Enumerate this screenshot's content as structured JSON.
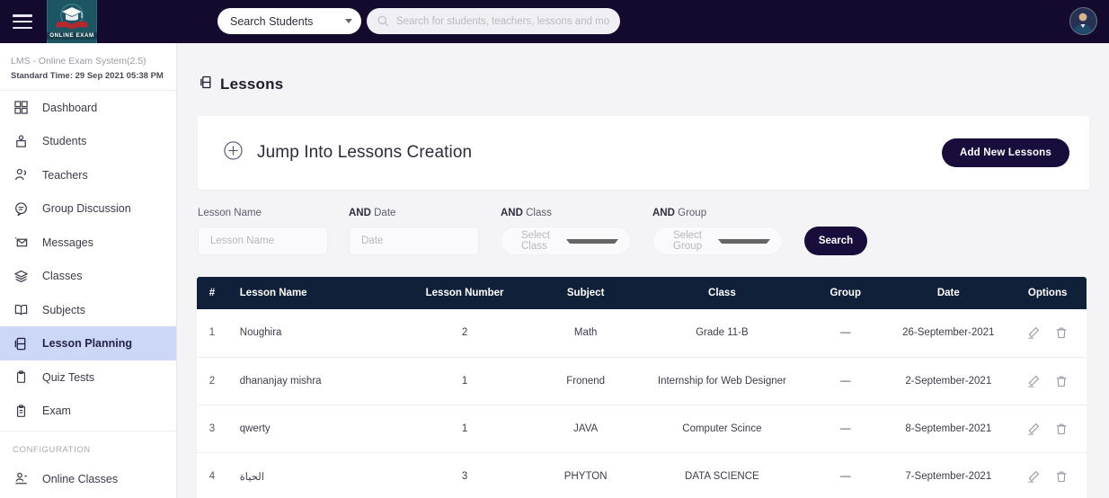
{
  "header": {
    "menu_icon": "hamburger-icon",
    "logo_text": "ONLINE EXAM",
    "search_scope": "Search Students",
    "search_placeholder": "Search for students, teachers, lessons and more..",
    "search_value": "",
    "avatar_icon": "user-avatar"
  },
  "sidebar": {
    "system_title": "LMS - Online Exam System(2.5)",
    "system_time": "Standard Time: 29 Sep 2021 05:38 PM",
    "items": [
      {
        "label": "Dashboard",
        "icon": "grid-icon",
        "active": false
      },
      {
        "label": "Students",
        "icon": "student-icon",
        "active": false
      },
      {
        "label": "Teachers",
        "icon": "teacher-icon",
        "active": false
      },
      {
        "label": "Group Discussion",
        "icon": "chat-icon",
        "active": false
      },
      {
        "label": "Messages",
        "icon": "envelope-icon",
        "active": false
      },
      {
        "label": "Classes",
        "icon": "layers-icon",
        "active": false
      },
      {
        "label": "Subjects",
        "icon": "book-icon",
        "active": false
      },
      {
        "label": "Lesson Planning",
        "icon": "lesson-icon",
        "active": true
      },
      {
        "label": "Quiz Tests",
        "icon": "clipboard-icon",
        "active": false
      },
      {
        "label": "Exam",
        "icon": "exam-clipboard-icon",
        "active": false
      }
    ],
    "section_label": "CONFIGURATION",
    "config_items": [
      {
        "label": "Online Classes",
        "icon": "online-class-icon",
        "active": false
      }
    ]
  },
  "main": {
    "page_title": "Lessons",
    "page_icon": "lesson-icon",
    "jump_card": {
      "plus_icon": "plus-circle-icon",
      "title": "Jump Into Lessons Creation",
      "add_button": "Add New Lessons"
    },
    "filters": {
      "lesson_name_label": "Lesson Name",
      "lesson_name_placeholder": "Lesson Name",
      "lesson_name_value": "",
      "date_label_prefix": "AND",
      "date_label": "Date",
      "date_placeholder": "Date",
      "date_value": "",
      "class_label_prefix": "AND",
      "class_label": "Class",
      "class_value": "Select Class",
      "group_label_prefix": "AND",
      "group_label": "Group",
      "group_value": "Select Group",
      "search_button": "Search"
    },
    "table": {
      "columns": [
        "#",
        "Lesson Name",
        "Lesson Number",
        "Subject",
        "Class",
        "Group",
        "Date",
        "Options"
      ],
      "rows": [
        {
          "num": "1",
          "name": "Noughira",
          "lesson_number": "2",
          "subject": "Math",
          "class": "Grade 11-B",
          "group": "—",
          "date": "26-September-2021",
          "edit_icon": "pencil-icon",
          "delete_icon": "trash-icon"
        },
        {
          "num": "2",
          "name": "dhananjay mishra",
          "lesson_number": "1",
          "subject": "Fronend",
          "class": "Internship for Web Designer",
          "group": "—",
          "date": "2-September-2021",
          "edit_icon": "pencil-icon",
          "delete_icon": "trash-icon"
        },
        {
          "num": "3",
          "name": "qwerty",
          "lesson_number": "1",
          "subject": "JAVA",
          "class": "Computer Scince",
          "group": "—",
          "date": "8-September-2021",
          "edit_icon": "pencil-icon",
          "delete_icon": "trash-icon"
        },
        {
          "num": "4",
          "name": "الحياة",
          "lesson_number": "3",
          "subject": "PHYTON",
          "class": "DATA SCIENCE",
          "group": "—",
          "date": "7-September-2021",
          "edit_icon": "pencil-icon",
          "delete_icon": "trash-icon"
        }
      ]
    }
  },
  "colors": {
    "topbar": "#130a2e",
    "accent_dark": "#190d3c",
    "table_header": "#102038",
    "active_nav": "#ccd7f7",
    "page_bg": "#f4f4f6",
    "logo_bg": "#1d5562"
  }
}
